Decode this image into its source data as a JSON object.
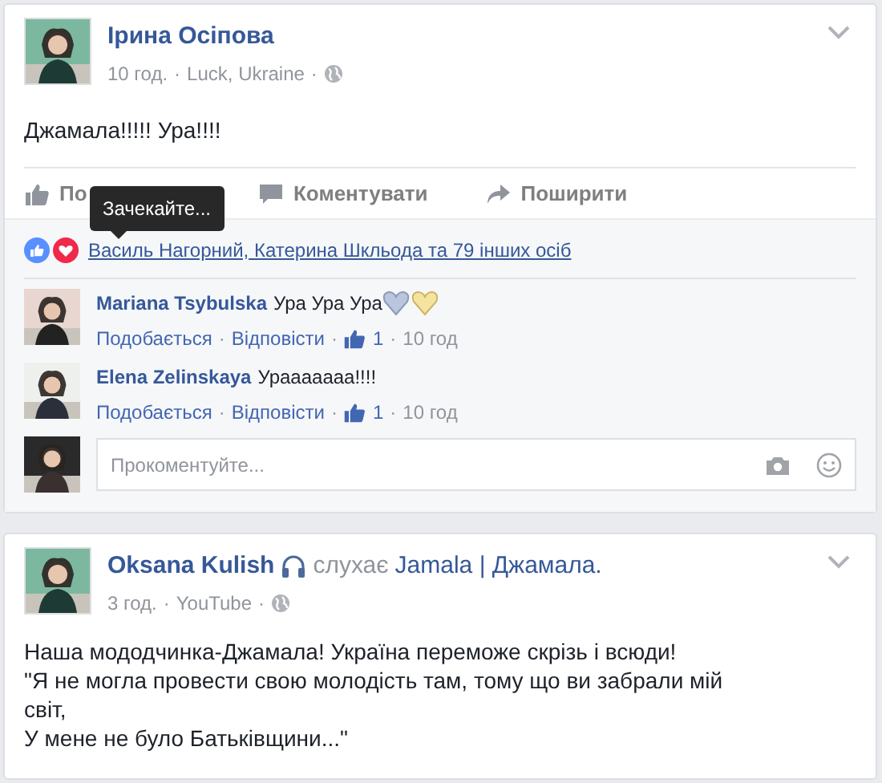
{
  "posts": [
    {
      "author": "Ірина Осіпова",
      "time": "10 год.",
      "location": "Luck, Ukraine",
      "meta_separators": [
        "·",
        "·"
      ],
      "text": [
        "Джамала!!!!! Ура!!!!"
      ],
      "actions": [
        {
          "kind": "like",
          "label": "По"
        },
        {
          "kind": "comment",
          "label": "Коментувати"
        },
        {
          "kind": "share",
          "label": "Поширити"
        }
      ],
      "tooltip": "Зачекайте...",
      "reactions": "Василь Нагорний, Катерина Шкльода та 79 інших осіб",
      "comments": [
        {
          "author": "Mariana Tsybulska",
          "text": "Ура Ура Ура",
          "hearts": true,
          "like": "Подобається",
          "reply": "Відповісти",
          "likes": "1",
          "time": "10 год",
          "separators": [
            "·",
            "·",
            "·"
          ]
        },
        {
          "author": "Elena Zelinskaya",
          "text": "Урааааааа!!!!",
          "hearts": false,
          "like": "Подобається",
          "reply": "Відповісти",
          "likes": "1",
          "time": "10 год",
          "separators": [
            "·",
            "·",
            "·"
          ]
        }
      ],
      "comment_field": {
        "placeholder": "Прокоментуйте..."
      }
    },
    {
      "author": "Oksana Kulish",
      "activity": {
        "verb": "слухає",
        "subject": "Jamala | Джамала."
      },
      "time": "3 год.",
      "location": "YouTube",
      "meta_separators": [
        "·",
        "·"
      ],
      "text": [
        "Наша мододчинка-Джамала! Україна переможе скрізь і всюди!",
        "\"Я не могла провести свою молодість там, тому що ви забрали мій світ,",
        "У мене не було Батьківщини...\""
      ]
    }
  ]
}
